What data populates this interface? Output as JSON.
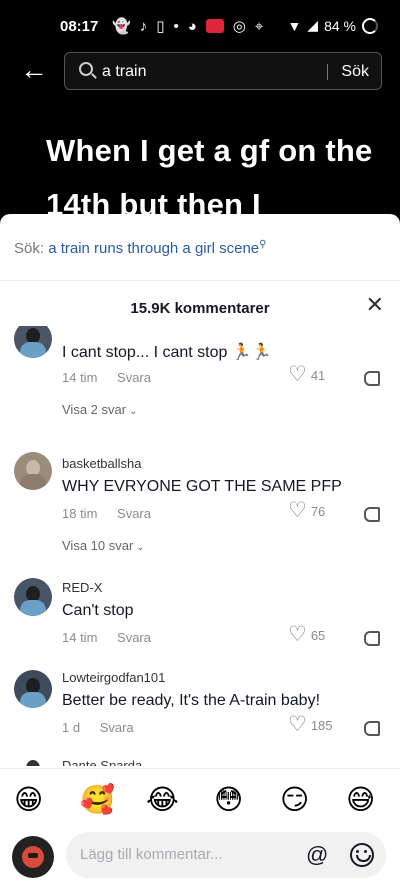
{
  "status_bar": {
    "time": "08:17",
    "battery": "84 %"
  },
  "search": {
    "query": "a train",
    "submit_label": "Sök"
  },
  "video": {
    "caption": "When I get a gf on the 14th but then I"
  },
  "comment_sheet": {
    "suggestion_prefix": "Sök:",
    "suggestion_link": "a train runs through a girl scene",
    "comment_count": "15.9K kommentarer",
    "comments": [
      {
        "username": "",
        "text": "I cant stop... I cant stop 🏃🏃",
        "time": "14 tim",
        "reply_label": "Svara",
        "likes": "41",
        "view_replies": "Visa 2 svar"
      },
      {
        "username": "basketballsha",
        "text": "WHY EVRYONE GOT THE SAME PFP",
        "time": "18 tim",
        "reply_label": "Svara",
        "likes": "76",
        "view_replies": "Visa 10 svar"
      },
      {
        "username": "RED-X",
        "text": "Can't stop",
        "time": "14 tim",
        "reply_label": "Svara",
        "likes": "65"
      },
      {
        "username": "Lowteirgodfan101",
        "text": "Better be ready, It's the A-train baby!",
        "time": "1 d",
        "reply_label": "Svara",
        "likes": "185"
      },
      {
        "username": "Dante Sparda"
      }
    ],
    "emoji_bar": [
      "😁",
      "🥰",
      "😂",
      "😳",
      "😏",
      "😅"
    ],
    "input_placeholder": "Lägg till kommentar...",
    "mention_symbol": "@"
  }
}
